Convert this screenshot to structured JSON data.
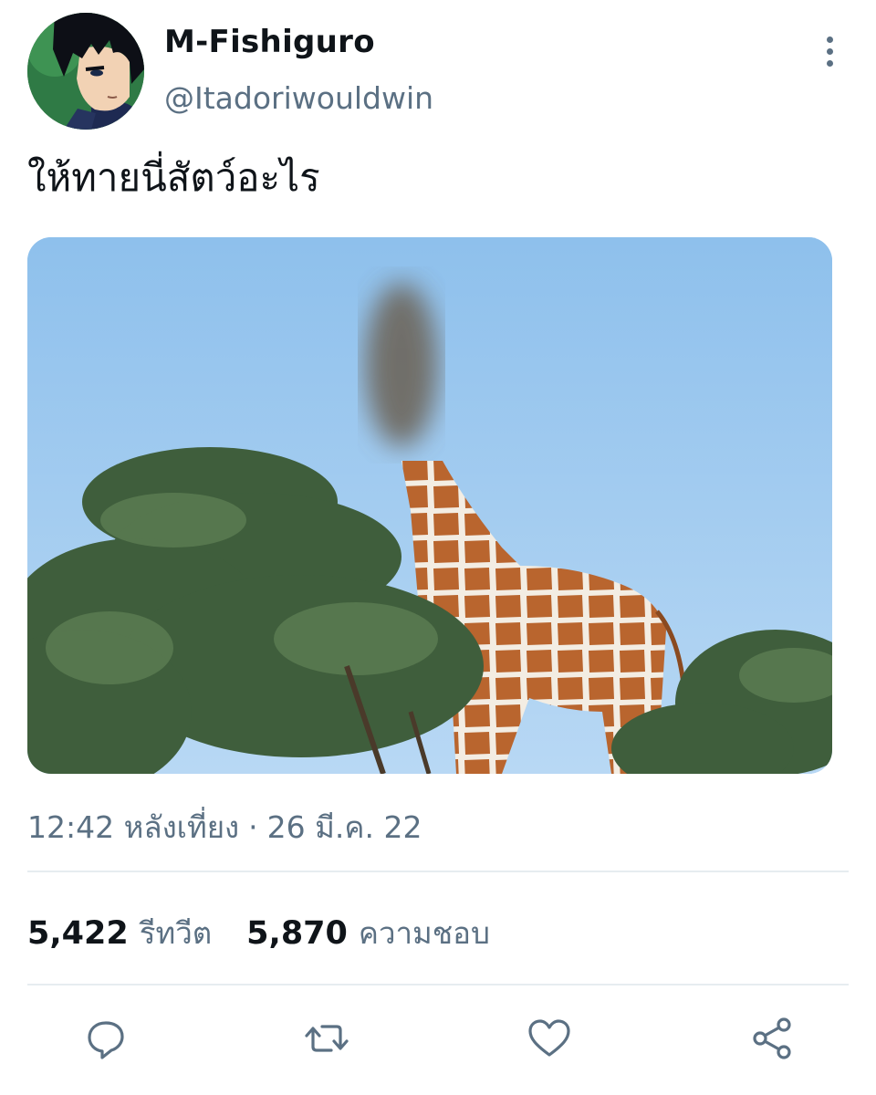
{
  "author": {
    "display_name": "M-Fishiguro",
    "handle": "@Itadoriwouldwin",
    "avatar_icon": "anime-character-avatar"
  },
  "tweet": {
    "text": "ให้ทายนี่สัตว์อะไร",
    "media_description_icon": "giraffe-photo-head-blurred",
    "time": "12:42 หลังเที่ยง",
    "separator": "·",
    "date": "26 มี.ค. 22"
  },
  "stats": {
    "retweets_count": "5,422",
    "retweets_label": "รีทวีต",
    "likes_count": "5,870",
    "likes_label": "ความชอบ"
  },
  "actions": {
    "reply_icon": "reply-icon",
    "retweet_icon": "retweet-icon",
    "like_icon": "heart-icon",
    "share_icon": "share-icon"
  },
  "colors": {
    "text_primary": "#0f1419",
    "text_secondary": "#5b7083",
    "divider": "#e6ecf0"
  }
}
